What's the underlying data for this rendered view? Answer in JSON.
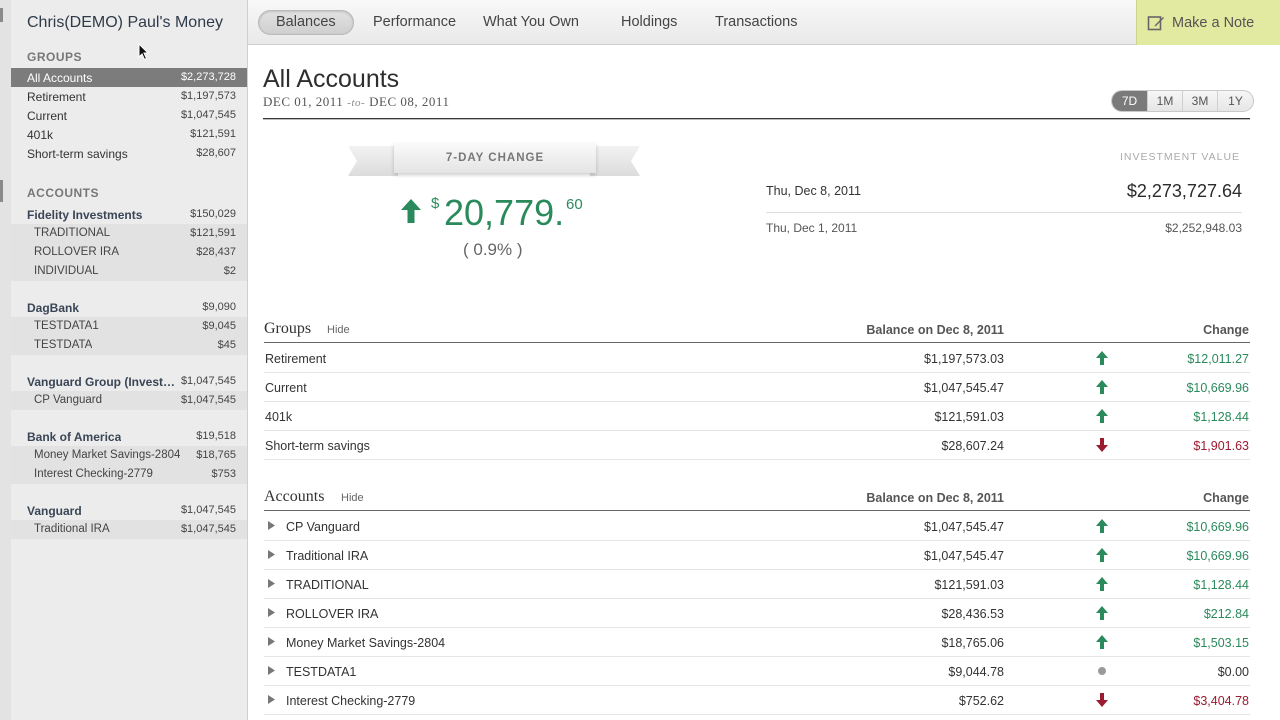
{
  "sidebar": {
    "title": "Chris(DEMO) Paul's Money",
    "groups_label": "GROUPS",
    "accounts_label": "ACCOUNTS",
    "groups": [
      {
        "label": "All Accounts",
        "amount": "$2,273,728"
      },
      {
        "label": "Retirement",
        "amount": "$1,197,573"
      },
      {
        "label": "Current",
        "amount": "$1,047,545"
      },
      {
        "label": "401k",
        "amount": "$121,591"
      },
      {
        "label": "Short-term savings",
        "amount": "$28,607"
      }
    ],
    "institutions": [
      {
        "label": "Fidelity Investments",
        "amount": "$150,029",
        "accounts": [
          {
            "label": "TRADITIONAL",
            "amount": "$121,591"
          },
          {
            "label": "ROLLOVER IRA",
            "amount": "$28,437"
          },
          {
            "label": "INDIVIDUAL",
            "amount": "$2"
          }
        ]
      },
      {
        "label": "DagBank",
        "amount": "$9,090",
        "accounts": [
          {
            "label": "TESTDATA1",
            "amount": "$9,045"
          },
          {
            "label": "TESTDATA",
            "amount": "$45"
          }
        ]
      },
      {
        "label": "Vanguard Group (Investments)",
        "amount": "$1,047,545",
        "accounts": [
          {
            "label": "CP Vanguard",
            "amount": "$1,047,545"
          }
        ]
      },
      {
        "label": "Bank of America",
        "amount": "$19,518",
        "accounts": [
          {
            "label": "Money Market Savings-2804",
            "amount": "$18,765"
          },
          {
            "label": "Interest Checking-2779",
            "amount": "$753"
          }
        ]
      },
      {
        "label": "Vanguard",
        "amount": "$1,047,545",
        "accounts": [
          {
            "label": "Traditional IRA",
            "amount": "$1,047,545"
          }
        ]
      }
    ]
  },
  "nav": {
    "tabs": [
      "Balances",
      "Performance",
      "What You Own",
      "Holdings",
      "Transactions"
    ],
    "note_label": "Make a Note"
  },
  "header": {
    "title": "All Accounts",
    "date_from": "DEC 01, 2011",
    "date_to_word": "-to-",
    "date_to": "DEC 08, 2011",
    "ranges": [
      "7D",
      "1M",
      "3M",
      "1Y"
    ]
  },
  "change": {
    "label": "7-DAY CHANGE",
    "currency": "$",
    "amount": "20,779.",
    "cents": "60",
    "percent": "( 0.9% )"
  },
  "investment": {
    "label": "INVESTMENT VALUE",
    "rows": [
      {
        "date": "Thu, Dec 8, 2011",
        "value": "$2,273,727.64"
      },
      {
        "date": "Thu, Dec 1, 2011",
        "value": "$2,252,948.03"
      }
    ]
  },
  "groups_table": {
    "title": "Groups",
    "hide": "Hide",
    "col_balance": "Balance on Dec 8, 2011",
    "col_change": "Change",
    "rows": [
      {
        "name": "Retirement",
        "balance": "$1,197,573.03",
        "change": "$12,011.27",
        "dir": "up"
      },
      {
        "name": "Current",
        "balance": "$1,047,545.47",
        "change": "$10,669.96",
        "dir": "up"
      },
      {
        "name": "401k",
        "balance": "$121,591.03",
        "change": "$1,128.44",
        "dir": "up"
      },
      {
        "name": "Short-term savings",
        "balance": "$28,607.24",
        "change": "$1,901.63",
        "dir": "down"
      }
    ]
  },
  "accounts_table": {
    "title": "Accounts",
    "hide": "Hide",
    "col_balance": "Balance on Dec 8, 2011",
    "col_change": "Change",
    "rows": [
      {
        "name": "CP Vanguard",
        "balance": "$1,047,545.47",
        "change": "$10,669.96",
        "dir": "up"
      },
      {
        "name": "Traditional IRA",
        "balance": "$1,047,545.47",
        "change": "$10,669.96",
        "dir": "up"
      },
      {
        "name": "TRADITIONAL",
        "balance": "$121,591.03",
        "change": "$1,128.44",
        "dir": "up"
      },
      {
        "name": "ROLLOVER IRA",
        "balance": "$28,436.53",
        "change": "$212.84",
        "dir": "up"
      },
      {
        "name": "Money Market Savings-2804",
        "balance": "$18,765.06",
        "change": "$1,503.15",
        "dir": "up"
      },
      {
        "name": "TESTDATA1",
        "balance": "$9,044.78",
        "change": "$0.00",
        "dir": "flat"
      },
      {
        "name": "Interest Checking-2779",
        "balance": "$752.62",
        "change": "$3,404.78",
        "dir": "down"
      }
    ]
  },
  "colors": {
    "up": "#2a8a5c",
    "down": "#9b1b30",
    "flat": "#9a9a9a",
    "note_bg": "#e2eaa2"
  }
}
